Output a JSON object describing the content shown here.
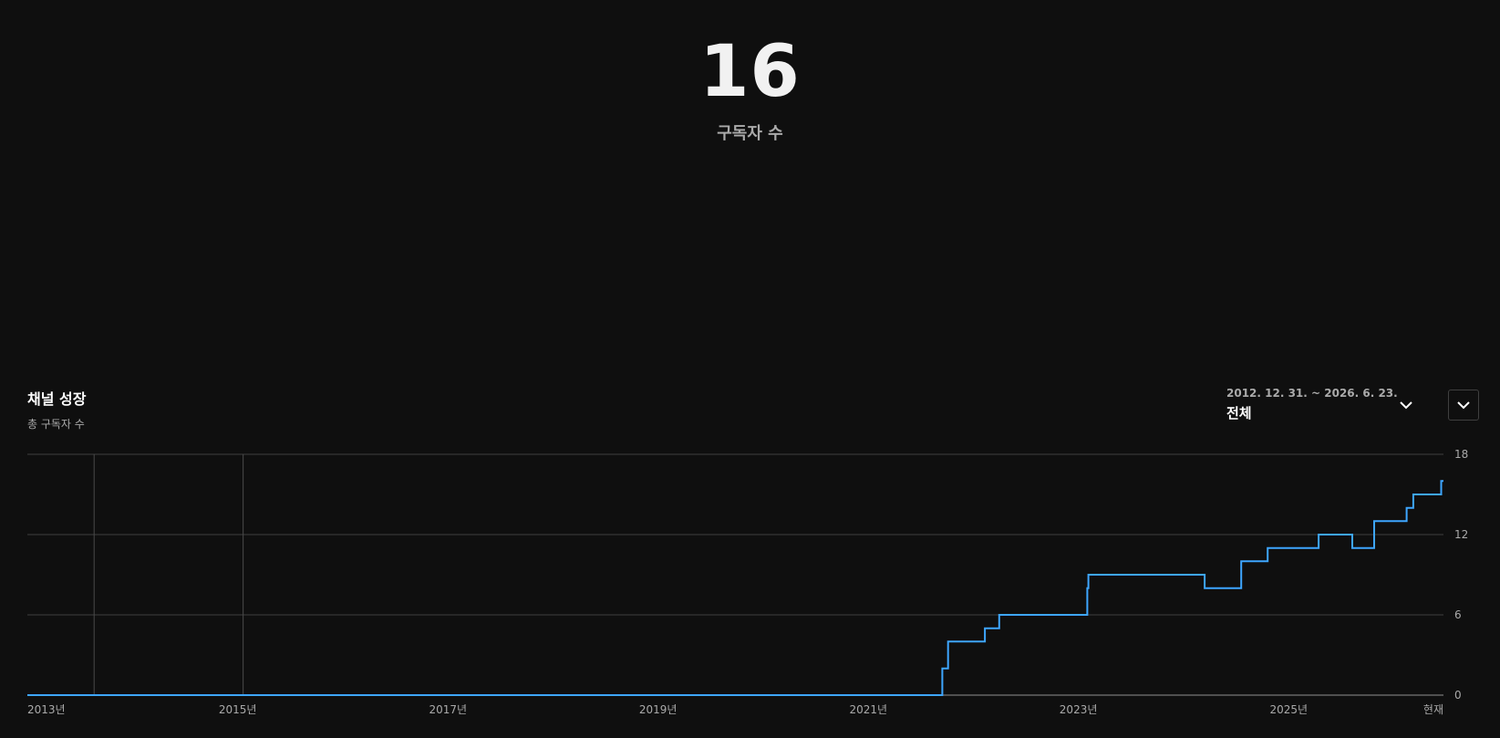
{
  "hero": {
    "value": "16",
    "label": "구독자 수"
  },
  "card": {
    "title": "채널 성장",
    "subtitle": "총 구독자 수"
  },
  "date_range": {
    "dates": "2012. 12. 31. ~ 2026. 6. 23.",
    "label": "전체"
  },
  "icons": {
    "range_dropdown": "chevron-down-icon",
    "card_menu": "chevron-down-icon"
  },
  "colors": {
    "line": "#3ea6ff",
    "background": "#0f0f0f",
    "grid": "#3f3f3f"
  },
  "chart_data": {
    "type": "line",
    "title": "채널 성장",
    "subtitle": "총 구독자 수",
    "xlabel": "",
    "ylabel": "",
    "x_range": [
      "2012-12-31",
      "2026-06-23"
    ],
    "ylim": [
      0,
      18
    ],
    "y_ticks": [
      0,
      6,
      12,
      18
    ],
    "x_ticks": [
      {
        "date": "2012-12-31",
        "label": "2013년"
      },
      {
        "date": "2015-01-01",
        "label": "2015년"
      },
      {
        "date": "2017-01-01",
        "label": "2017년"
      },
      {
        "date": "2019-01-01",
        "label": "2019년"
      },
      {
        "date": "2021-01-01",
        "label": "2021년"
      },
      {
        "date": "2023-01-01",
        "label": "2023년"
      },
      {
        "date": "2025-01-01",
        "label": "2025년"
      },
      {
        "date": "2026-06-23",
        "label": "현재"
      }
    ],
    "event_markers": [
      "2013-08-20",
      "2015-01-20"
    ],
    "grid": true,
    "legend": "none",
    "series": [
      {
        "step": true,
        "points": [
          [
            "2012-12-31",
            0
          ],
          [
            "2021-09-15",
            0
          ],
          [
            "2021-09-15",
            2
          ],
          [
            "2021-10-05",
            2
          ],
          [
            "2021-10-05",
            4
          ],
          [
            "2022-02-10",
            4
          ],
          [
            "2022-02-10",
            5
          ],
          [
            "2022-04-01",
            5
          ],
          [
            "2022-04-01",
            6
          ],
          [
            "2023-02-01",
            6
          ],
          [
            "2023-02-01",
            8
          ],
          [
            "2023-02-05",
            8
          ],
          [
            "2023-02-05",
            9
          ],
          [
            "2024-03-15",
            9
          ],
          [
            "2024-03-15",
            8
          ],
          [
            "2024-07-20",
            8
          ],
          [
            "2024-07-20",
            10
          ],
          [
            "2024-10-20",
            10
          ],
          [
            "2024-10-20",
            11
          ],
          [
            "2025-04-15",
            11
          ],
          [
            "2025-04-15",
            12
          ],
          [
            "2025-08-10",
            12
          ],
          [
            "2025-08-10",
            11
          ],
          [
            "2025-10-25",
            11
          ],
          [
            "2025-10-25",
            13
          ],
          [
            "2026-02-15",
            13
          ],
          [
            "2026-02-15",
            14
          ],
          [
            "2026-03-10",
            14
          ],
          [
            "2026-03-10",
            15
          ],
          [
            "2026-06-15",
            15
          ],
          [
            "2026-06-15",
            16
          ],
          [
            "2026-06-23",
            16
          ]
        ]
      }
    ]
  }
}
